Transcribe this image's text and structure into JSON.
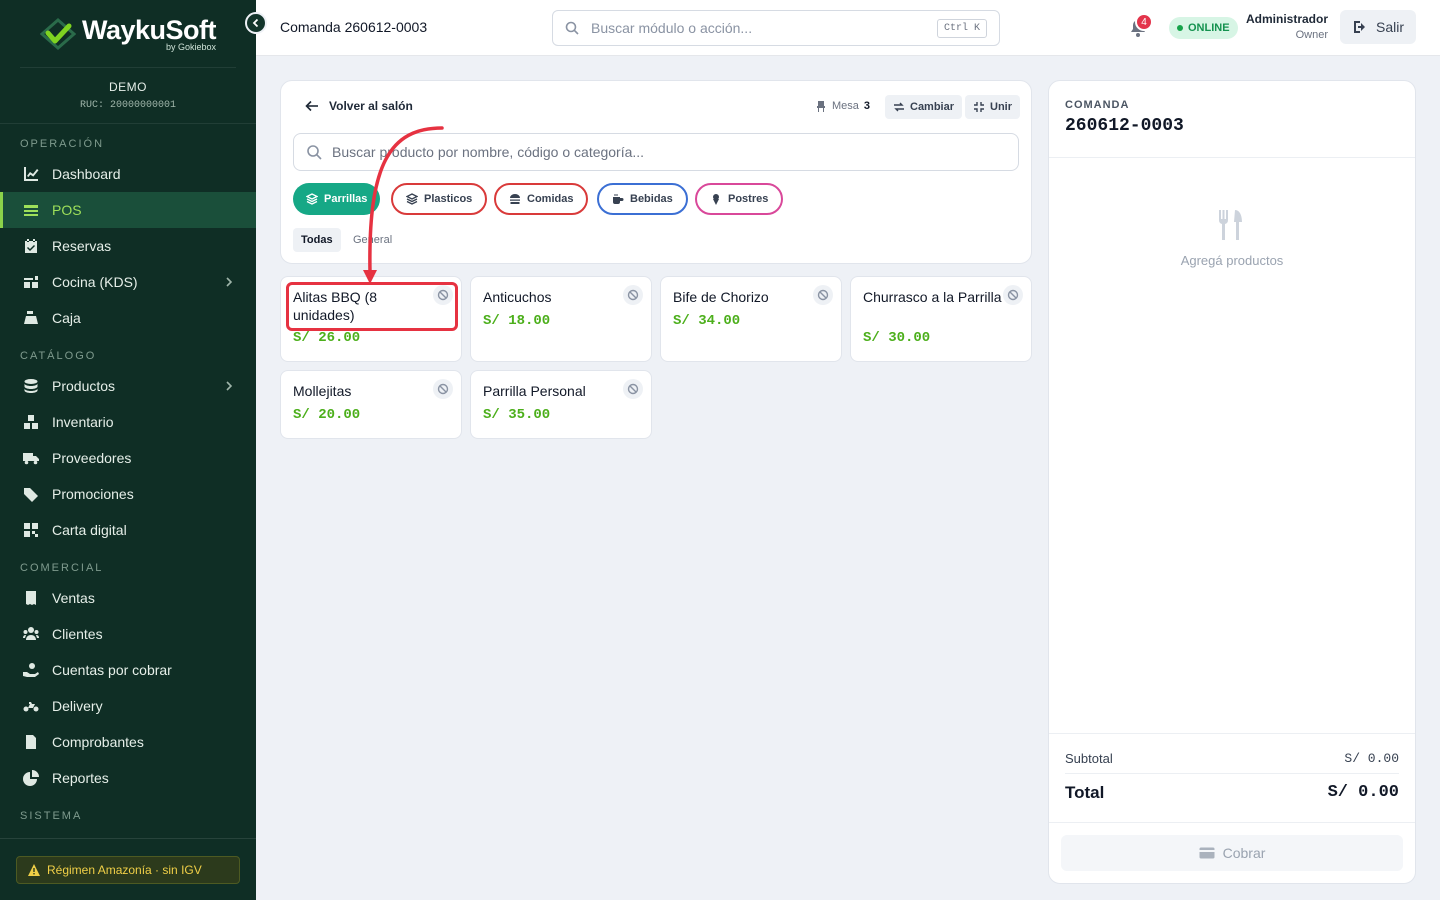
{
  "brand": {
    "name": "WaykuSoft",
    "by": "by Gokiebox"
  },
  "tenant": {
    "name": "DEMO",
    "ruc": "RUC: 20000000001"
  },
  "sidebar": {
    "sections": [
      {
        "title": "OPERACIÓN",
        "items": [
          {
            "label": "Dashboard",
            "icon": "chart-line-icon"
          },
          {
            "label": "POS",
            "icon": "layers-icon",
            "active": true
          },
          {
            "label": "Reservas",
            "icon": "calendar-check-icon"
          },
          {
            "label": "Cocina (KDS)",
            "icon": "kitchen-icon",
            "has_children": true
          },
          {
            "label": "Caja",
            "icon": "cash-register-icon"
          }
        ]
      },
      {
        "title": "CATÁLOGO",
        "items": [
          {
            "label": "Productos",
            "icon": "database-icon",
            "has_children": true
          },
          {
            "label": "Inventario",
            "icon": "boxes-icon"
          },
          {
            "label": "Proveedores",
            "icon": "truck-icon"
          },
          {
            "label": "Promociones",
            "icon": "tags-icon"
          },
          {
            "label": "Carta digital",
            "icon": "qrcode-icon"
          }
        ]
      },
      {
        "title": "COMERCIAL",
        "items": [
          {
            "label": "Ventas",
            "icon": "receipt-icon"
          },
          {
            "label": "Clientes",
            "icon": "users-icon"
          },
          {
            "label": "Cuentas por cobrar",
            "icon": "hand-money-icon"
          },
          {
            "label": "Delivery",
            "icon": "motorcycle-icon"
          },
          {
            "label": "Comprobantes",
            "icon": "file-invoice-icon"
          },
          {
            "label": "Reportes",
            "icon": "pie-chart-icon"
          }
        ]
      },
      {
        "title": "SISTEMA",
        "items": []
      }
    ],
    "regimen": "Régimen Amazonía · sin IGV"
  },
  "topbar": {
    "title": "Comanda 260612-0003",
    "search_placeholder": "Buscar módulo o acción...",
    "shortcut": "Ctrl K",
    "notifications": "4",
    "status": "ONLINE",
    "user_name": "Administrador",
    "user_role": "Owner",
    "logout": "Salir"
  },
  "pos": {
    "back": "Volver al salón",
    "mesa_label": "Mesa",
    "mesa_number": "3",
    "cambiar": "Cambiar",
    "unir": "Unir",
    "search_placeholder": "Buscar producto por nombre, código o categoría...",
    "categories": [
      {
        "label": "Parrillas",
        "color": "#16a886",
        "active": true
      },
      {
        "label": "Plasticos",
        "color": "#d93a3a"
      },
      {
        "label": "Comidas",
        "color": "#d93a3a"
      },
      {
        "label": "Bebidas",
        "color": "#3b6fd4"
      },
      {
        "label": "Postres",
        "color": "#d9489a"
      }
    ],
    "subcategories": [
      "Todas",
      "General"
    ],
    "products": [
      {
        "name": "Alitas BBQ (8 unidades)",
        "price": "S/ 26.00"
      },
      {
        "name": "Anticuchos",
        "price": "S/ 18.00"
      },
      {
        "name": "Bife de Chorizo",
        "price": "S/ 34.00"
      },
      {
        "name": "Churrasco a la Parrilla",
        "price": "S/ 30.00"
      },
      {
        "name": "Mollejitas",
        "price": "S/ 20.00"
      },
      {
        "name": "Parrilla Personal",
        "price": "S/ 35.00"
      }
    ]
  },
  "order": {
    "label": "COMANDA",
    "number": "260612-0003",
    "empty": "Agregá productos",
    "subtotal_label": "Subtotal",
    "subtotal": "S/ 0.00",
    "total_label": "Total",
    "total": "S/ 0.00",
    "pay": "Cobrar"
  },
  "colors": {
    "sidebar": "#0f2e25",
    "accent": "#9ee05a",
    "price": "#4caf1b",
    "annotation": "#e63241"
  }
}
